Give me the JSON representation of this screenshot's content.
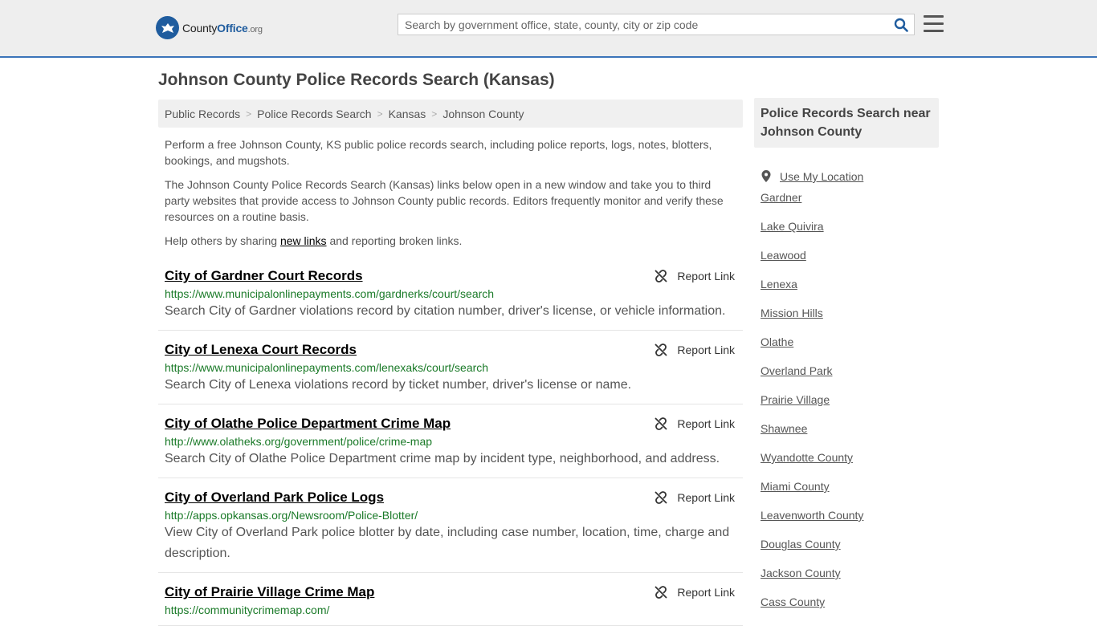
{
  "header": {
    "logo_county": "County",
    "logo_office": "Office",
    "logo_tld": ".org",
    "search_placeholder": "Search by government office, state, county, city or zip code"
  },
  "page_title": "Johnson County Police Records Search (Kansas)",
  "breadcrumb": [
    "Public Records",
    "Police Records Search",
    "Kansas",
    "Johnson County"
  ],
  "intro": {
    "p1": "Perform a free Johnson County, KS public police records search, including police reports, logs, notes, blotters, bookings, and mugshots.",
    "p2": "The Johnson County Police Records Search (Kansas) links below open in a new window and take you to third party websites that provide access to Johnson County public records. Editors frequently monitor and verify these resources on a routine basis.",
    "p3_before": "Help others by sharing ",
    "p3_link": "new links",
    "p3_after": " and reporting broken links."
  },
  "report_label": "Report Link",
  "results": [
    {
      "title": "City of Gardner Court Records",
      "url": "https://www.municipalonlinepayments.com/gardnerks/court/search",
      "desc": "Search City of Gardner violations record by citation number, driver's license, or vehicle information."
    },
    {
      "title": "City of Lenexa Court Records",
      "url": "https://www.municipalonlinepayments.com/lenexaks/court/search",
      "desc": "Search City of Lenexa violations record by ticket number, driver's license or name."
    },
    {
      "title": "City of Olathe Police Department Crime Map",
      "url": "http://www.olatheks.org/government/police/crime-map",
      "desc": "Search City of Olathe Police Department crime map by incident type, neighborhood, and address."
    },
    {
      "title": "City of Overland Park Police Logs",
      "url": "http://apps.opkansas.org/Newsroom/Police-Blotter/",
      "desc": "View City of Overland Park police blotter by date, including case number, location, time, charge and description."
    },
    {
      "title": "City of Prairie Village Crime Map",
      "url": "https://communitycrimemap.com/",
      "desc": ""
    }
  ],
  "sidebar": {
    "heading": "Police Records Search near Johnson County",
    "use_location": "Use My Location",
    "items": [
      "Gardner",
      "Lake Quivira",
      "Leawood",
      "Lenexa",
      "Mission Hills",
      "Olathe",
      "Overland Park",
      "Prairie Village",
      "Shawnee",
      "Wyandotte County",
      "Miami County",
      "Leavenworth County",
      "Douglas County",
      "Jackson County",
      "Cass County"
    ]
  },
  "colors": {
    "accent": "#3b73b9",
    "link_green": "#1a7a28",
    "logo_blue": "#1f5c9e"
  }
}
